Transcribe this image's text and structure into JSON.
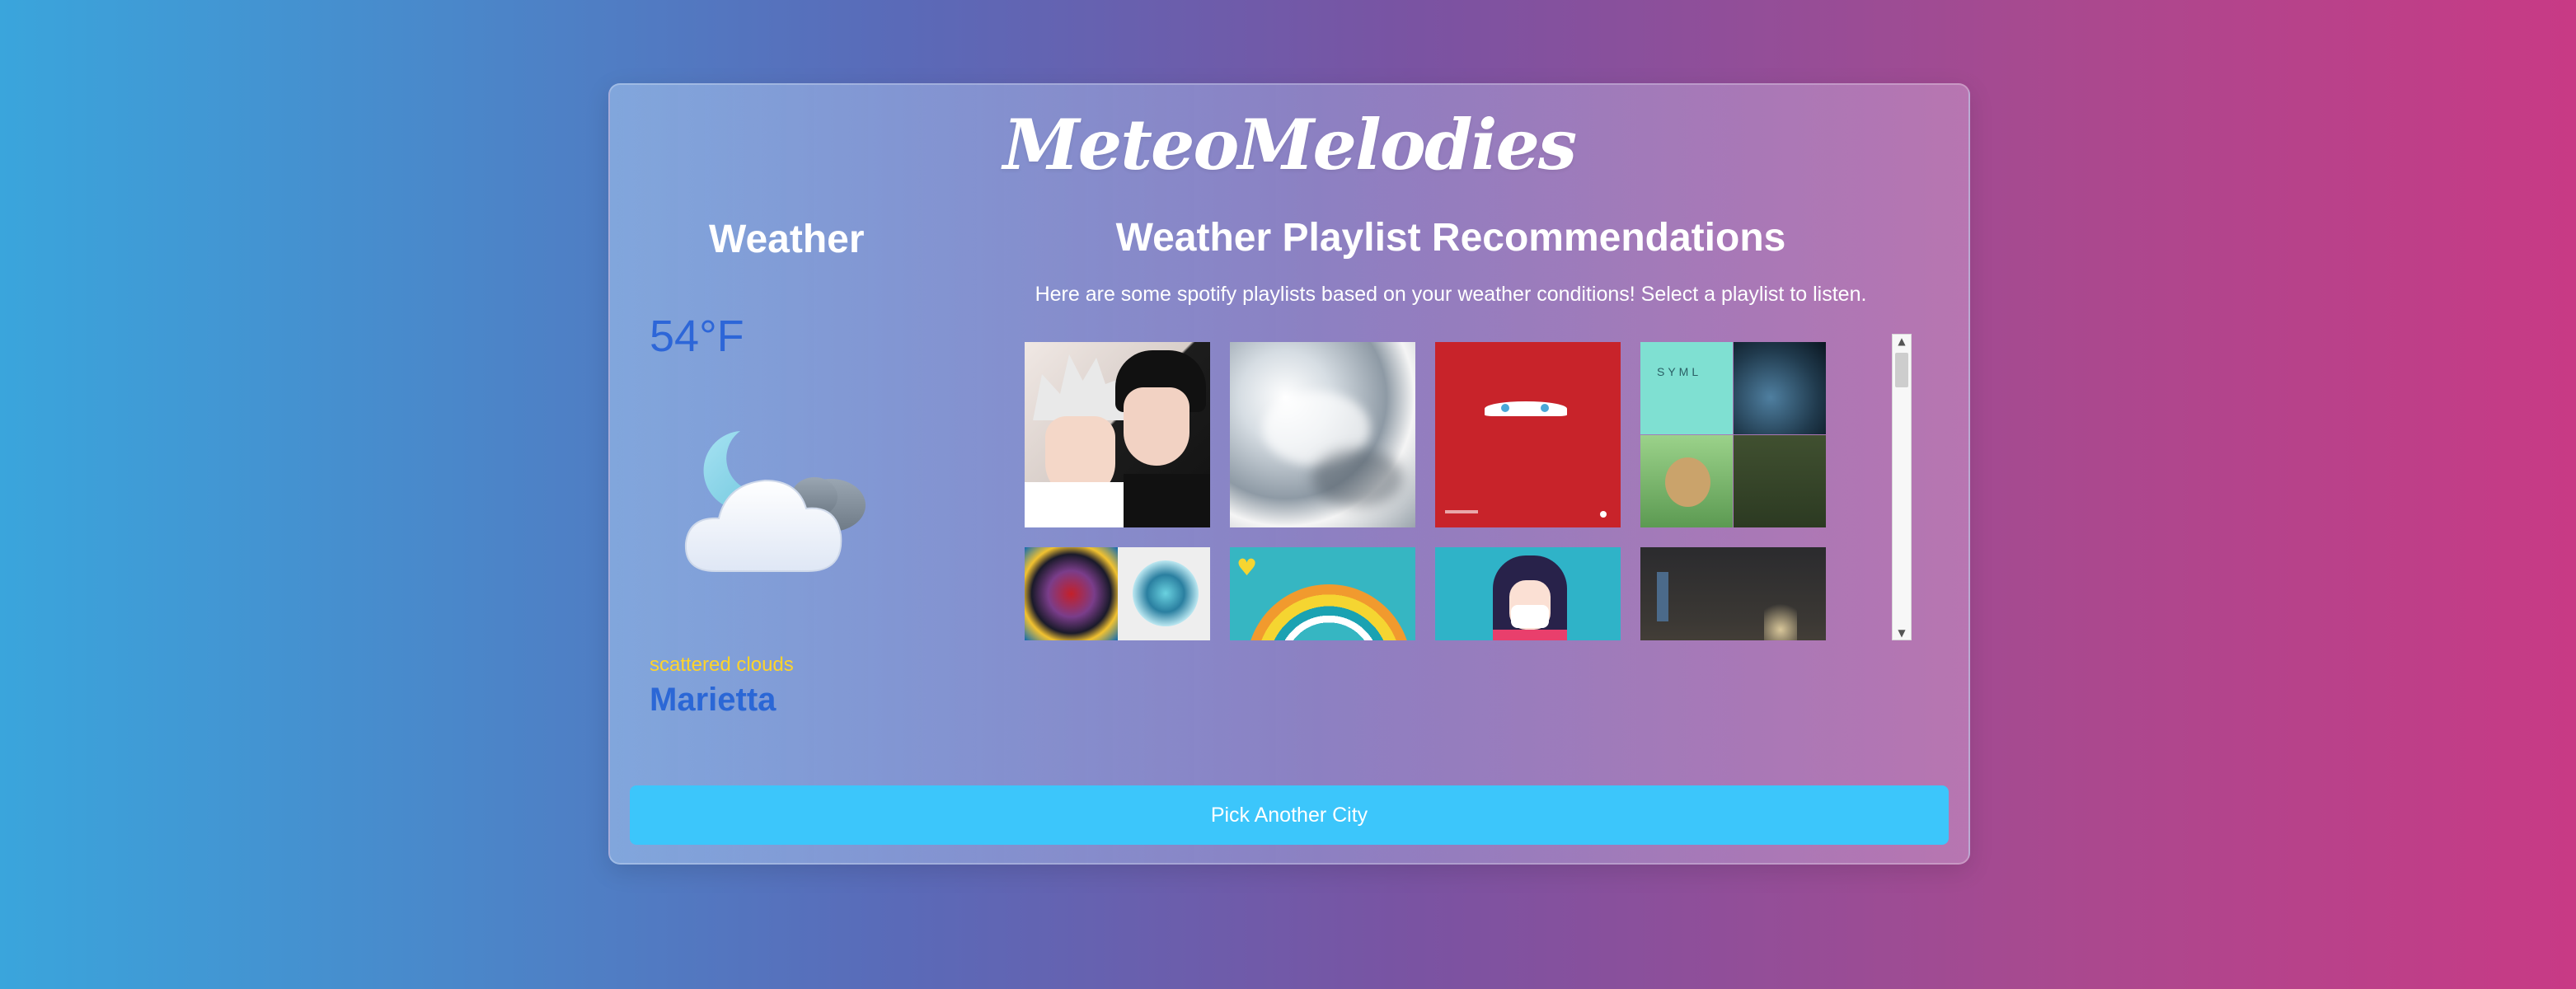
{
  "app": {
    "brand": "MeteoMelodies"
  },
  "weather": {
    "heading": "Weather",
    "temperature": "54°F",
    "description": "scattered clouds",
    "city": "Marietta",
    "icon": "partly-cloudy-night-icon"
  },
  "recommendations": {
    "heading": "Weather Playlist Recommendations",
    "subtitle": "Here are some spotify playlists based on your weather conditions! Select a playlist to listen.",
    "playlists": [
      {
        "art": "anime-duo-cover",
        "quad_text": ""
      },
      {
        "art": "cloudy-sky-cover",
        "quad_text": ""
      },
      {
        "art": "red-car-eyes-cover",
        "quad_text": ""
      },
      {
        "art": "four-album-collage-cover",
        "quad_text": "SYML"
      },
      {
        "art": "two-album-collage-cover",
        "quad_text": ""
      },
      {
        "art": "rainbow-cover",
        "quad_text": ""
      },
      {
        "art": "anime-girl-mask-cover",
        "quad_text": ""
      },
      {
        "art": "dark-street-cover",
        "quad_text": ""
      }
    ]
  },
  "actions": {
    "pick_city": "Pick Another City"
  },
  "scrollbar": {
    "up": "▲",
    "down": "▼"
  },
  "colors": {
    "temperature": "#2d66d8",
    "description": "#ffd42a",
    "button": "#3cc6fb"
  }
}
